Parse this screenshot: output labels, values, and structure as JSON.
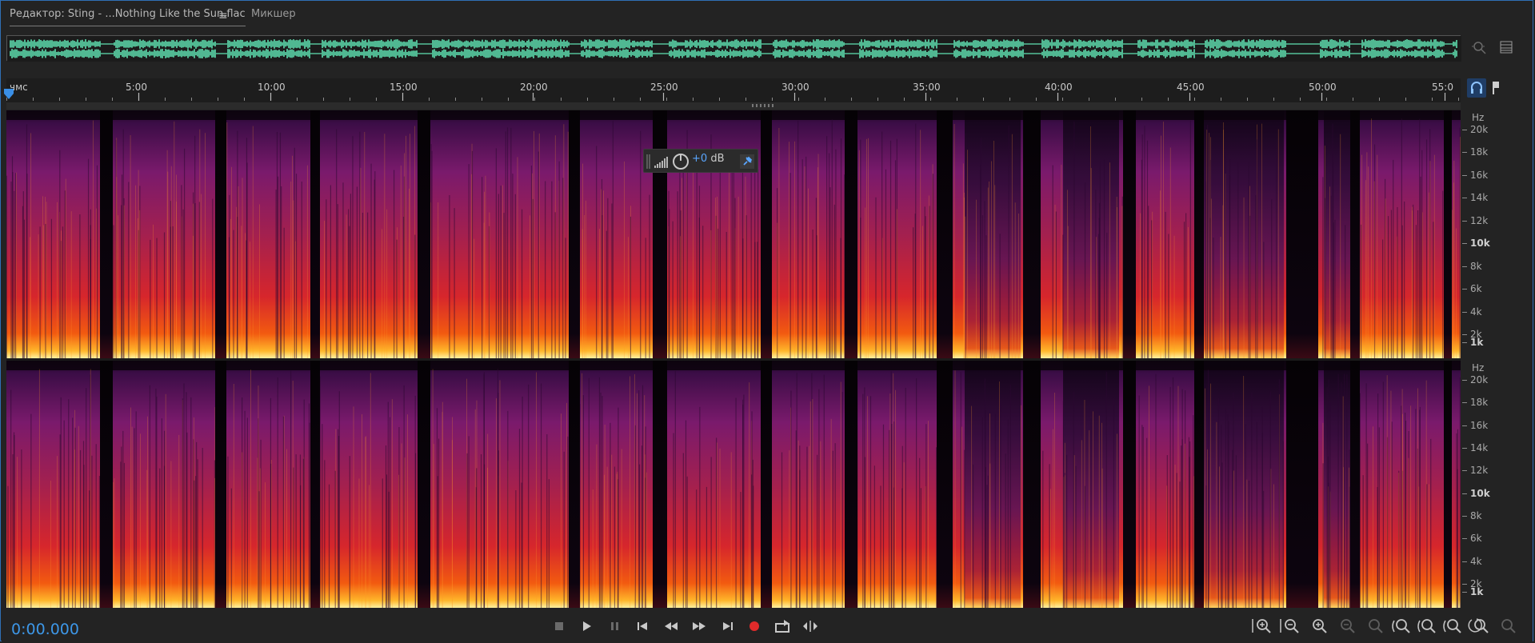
{
  "tabs": {
    "editor_label": "Редактор: Sting - ...Nothing Like the Sun.flac",
    "editor_menu_glyph": "≡",
    "mixer_label": "Микшер"
  },
  "ruler": {
    "labels": [
      "чмс",
      "5:00",
      "10:00",
      "15:00",
      "20:00",
      "25:00",
      "30:00",
      "35:00",
      "40:00",
      "45:00",
      "50:00",
      "55:0"
    ]
  },
  "freq_axis": {
    "unit": "Hz",
    "labels": [
      "20k",
      "18k",
      "16k",
      "14k",
      "12k",
      "10k",
      "8k",
      "6k",
      "4k",
      "2k",
      "1k"
    ],
    "major": [
      "10k",
      "1k"
    ]
  },
  "hud": {
    "gain_value": "+0",
    "gain_unit": "dB"
  },
  "time_display": "0:00.000",
  "colors": {
    "accent": "#3d97e8",
    "waveform": "#5fe0b0",
    "record": "#e02b2b",
    "monitor_active": "#1f3d66"
  },
  "transport_icons": [
    "stop-icon",
    "play-icon",
    "pause-icon",
    "go-to-start-icon",
    "rewind-icon",
    "fast-forward-icon",
    "go-to-end-icon",
    "record-icon",
    "loop-playback-icon",
    "skip-selection-icon"
  ],
  "zoom_icons": [
    "zoom-in-amplitude-icon",
    "zoom-out-amplitude-icon",
    "zoom-in-time-icon",
    "zoom-out-time-icon",
    "zoom-reset-icon",
    "zoom-in-left-icon",
    "zoom-in-right-icon",
    "zoom-full-icon",
    "zoom-selection-icon",
    "zoom-out-full-icon"
  ]
}
